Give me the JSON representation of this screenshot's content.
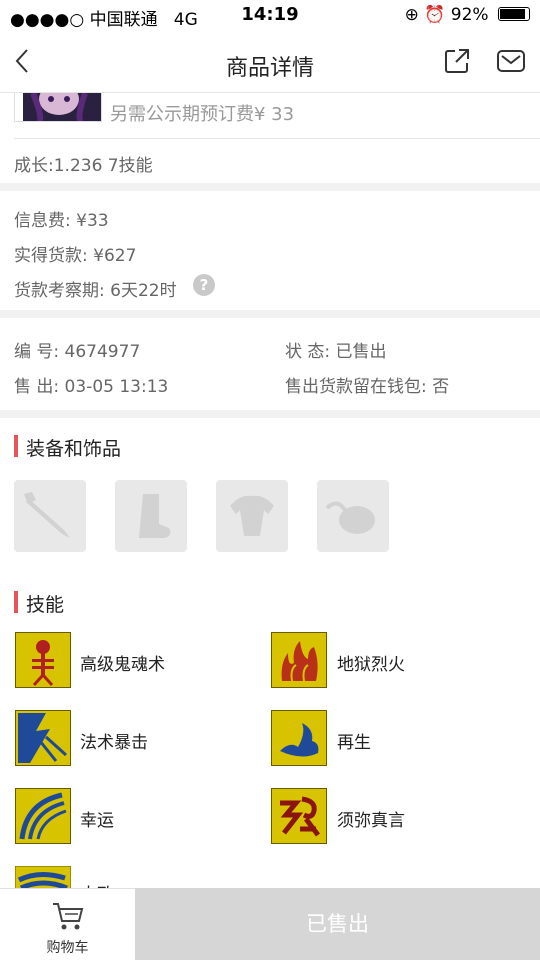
{
  "status": {
    "carrier": "●●●●○ 中国联通",
    "network": "4G",
    "time": "14:19",
    "battery": "92%"
  },
  "nav": {
    "title": "商品详情"
  },
  "item": {
    "deposit_note": "另需公示期预订费¥ 33",
    "growth": "成长:1.236 7技能"
  },
  "fees": {
    "info_fee": "信息费: ¥33",
    "actual": "实得货款: ¥627",
    "period": "货款考察期: 6天22时"
  },
  "details": {
    "id_label": "编 号:",
    "id": "4674977",
    "status_label": "状 态:",
    "status": "已售出",
    "sold_label": "售 出:",
    "sold": "03-05 13:13",
    "wallet_label": "售出货款留在钱包:",
    "wallet": "否"
  },
  "equipment": {
    "title": "装备和饰品"
  },
  "skills": {
    "title": "技能",
    "items": [
      "高级鬼魂术",
      "地狱烈火",
      "法术暴击",
      "再生",
      "幸运",
      "须弥真言",
      "大政"
    ]
  },
  "bottom": {
    "cart": "购物车",
    "sold_button": "已售出"
  },
  "colors": {
    "accent": "#e8545b",
    "skill_bg": "#d8c300"
  }
}
